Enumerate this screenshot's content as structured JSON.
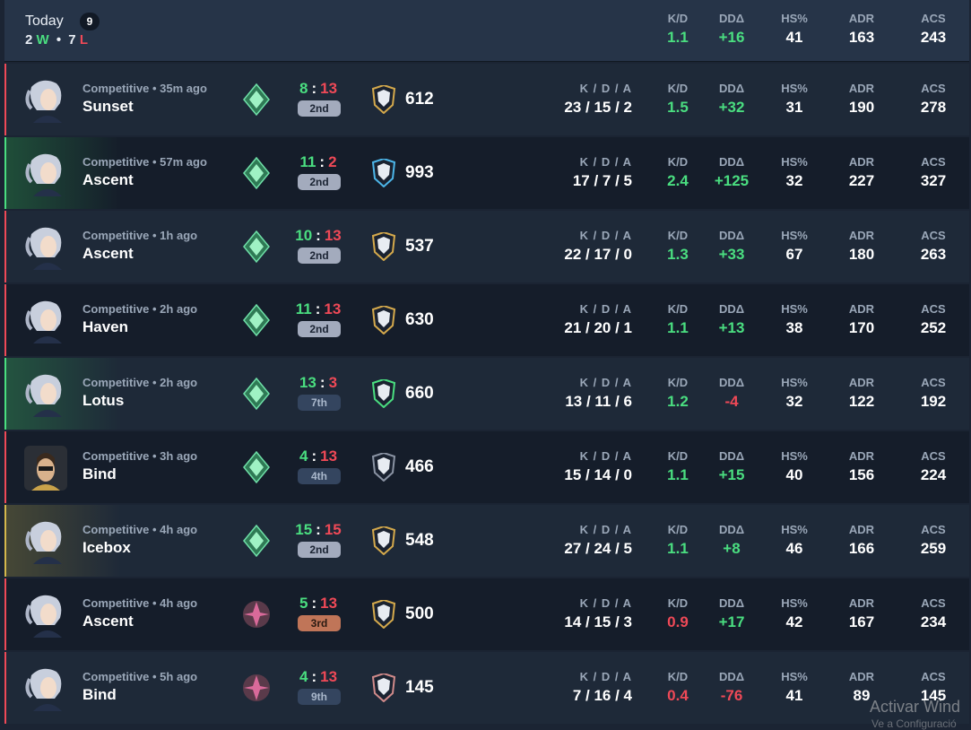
{
  "summary": {
    "day_label": "Today",
    "match_count": "9",
    "wins_num": "2",
    "wins_letter": "W",
    "dot": "•",
    "losses_num": "7",
    "losses_letter": "L",
    "stats": [
      {
        "label": "K/D",
        "value": "1.1"
      },
      {
        "label": "DDΔ",
        "value": "+16"
      },
      {
        "label": "HS%",
        "value": "41"
      },
      {
        "label": "ADR",
        "value": "163"
      },
      {
        "label": "ACS",
        "value": "243"
      }
    ]
  },
  "labels": {
    "kda": "K / D / A",
    "kd": "K/D",
    "dd": "DDΔ",
    "hs": "HS%",
    "adr": "ADR",
    "acs": "ACS",
    "sep": ":"
  },
  "matches": [
    {
      "result": "loss",
      "agent": "jett-avatar",
      "mode": "Competitive • 35m ago",
      "map": "Sunset",
      "team": "8",
      "enemy": "13",
      "place": "2nd",
      "place_style": "grey",
      "rank_icon": "ascendant-rank-icon",
      "rr_color": "#d4a94c",
      "rr": "612",
      "kda": "23 / 15 / 2",
      "kd": "1.5",
      "kd_sign": "pos",
      "dd": "+32",
      "dd_sign": "pos",
      "hs": "31",
      "adr": "190",
      "acs": "278"
    },
    {
      "result": "win",
      "agent": "jett-avatar",
      "mode": "Competitive • 57m ago",
      "map": "Ascent",
      "team": "11",
      "enemy": "2",
      "place": "2nd",
      "place_style": "grey",
      "rank_icon": "ascendant-rank-icon",
      "rr_color": "#4cb5e8",
      "rr": "993",
      "kda": "17 / 7 / 5",
      "kd": "2.4",
      "kd_sign": "pos",
      "dd": "+125",
      "dd_sign": "pos",
      "hs": "32",
      "adr": "227",
      "acs": "327"
    },
    {
      "result": "loss",
      "agent": "jett-avatar",
      "mode": "Competitive • 1h ago",
      "map": "Ascent",
      "team": "10",
      "enemy": "13",
      "place": "2nd",
      "place_style": "grey",
      "rank_icon": "ascendant-rank-icon",
      "rr_color": "#d4a94c",
      "rr": "537",
      "kda": "22 / 17 / 0",
      "kd": "1.3",
      "kd_sign": "pos",
      "dd": "+33",
      "dd_sign": "pos",
      "hs": "67",
      "adr": "180",
      "acs": "263"
    },
    {
      "result": "loss",
      "agent": "jett-avatar",
      "mode": "Competitive • 2h ago",
      "map": "Haven",
      "team": "11",
      "enemy": "13",
      "place": "2nd",
      "place_style": "grey",
      "rank_icon": "ascendant-rank-icon",
      "rr_color": "#d4a94c",
      "rr": "630",
      "kda": "21 / 20 / 1",
      "kd": "1.1",
      "kd_sign": "pos",
      "dd": "+13",
      "dd_sign": "pos",
      "hs": "38",
      "adr": "170",
      "acs": "252"
    },
    {
      "result": "win",
      "agent": "jett-avatar",
      "mode": "Competitive • 2h ago",
      "map": "Lotus",
      "team": "13",
      "enemy": "3",
      "place": "7th",
      "place_style": "blue",
      "rank_icon": "ascendant-rank-icon",
      "rr_color": "#4ade80",
      "rr": "660",
      "kda": "13 / 11 / 6",
      "kd": "1.2",
      "kd_sign": "pos",
      "dd": "-4",
      "dd_sign": "neg",
      "hs": "32",
      "adr": "122",
      "acs": "192"
    },
    {
      "result": "loss",
      "agent": "chamber-avatar",
      "mode": "Competitive • 3h ago",
      "map": "Bind",
      "team": "4",
      "enemy": "13",
      "place": "4th",
      "place_style": "blue",
      "rank_icon": "ascendant-rank-icon",
      "rr_color": "#8a93a3",
      "rr": "466",
      "kda": "15 / 14 / 0",
      "kd": "1.1",
      "kd_sign": "pos",
      "dd": "+15",
      "dd_sign": "pos",
      "hs": "40",
      "adr": "156",
      "acs": "224"
    },
    {
      "result": "draw",
      "agent": "jett-avatar",
      "mode": "Competitive • 4h ago",
      "map": "Icebox",
      "team": "15",
      "enemy": "15",
      "place": "2nd",
      "place_style": "grey",
      "rank_icon": "ascendant-rank-icon",
      "rr_color": "#d4a94c",
      "rr": "548",
      "kda": "27 / 24 / 5",
      "kd": "1.1",
      "kd_sign": "pos",
      "dd": "+8",
      "dd_sign": "pos",
      "hs": "46",
      "adr": "166",
      "acs": "259"
    },
    {
      "result": "loss",
      "agent": "jett-avatar",
      "mode": "Competitive • 4h ago",
      "map": "Ascent",
      "team": "5",
      "enemy": "13",
      "place": "3rd",
      "place_style": "bronze",
      "rank_icon": "immortal-rank-icon",
      "rr_color": "#d4a94c",
      "rr": "500",
      "kda": "14 / 15 / 3",
      "kd": "0.9",
      "kd_sign": "neg",
      "dd": "+17",
      "dd_sign": "pos",
      "hs": "42",
      "adr": "167",
      "acs": "234"
    },
    {
      "result": "loss",
      "agent": "jett-avatar",
      "mode": "Competitive • 5h ago",
      "map": "Bind",
      "team": "4",
      "enemy": "13",
      "place": "9th",
      "place_style": "blue",
      "rank_icon": "immortal-rank-icon",
      "rr_color": "#d08a8a",
      "rr": "145",
      "kda": "7 / 16 / 4",
      "kd": "0.4",
      "kd_sign": "neg",
      "dd": "-76",
      "dd_sign": "neg",
      "hs": "41",
      "adr": "89",
      "acs": "145"
    }
  ],
  "colors": {
    "win": "#4ade80",
    "loss": "#ef4957",
    "draw": "#d4b84c"
  },
  "watermark": {
    "line1": "Activar Wind",
    "line2": "Ve a Configuració"
  }
}
